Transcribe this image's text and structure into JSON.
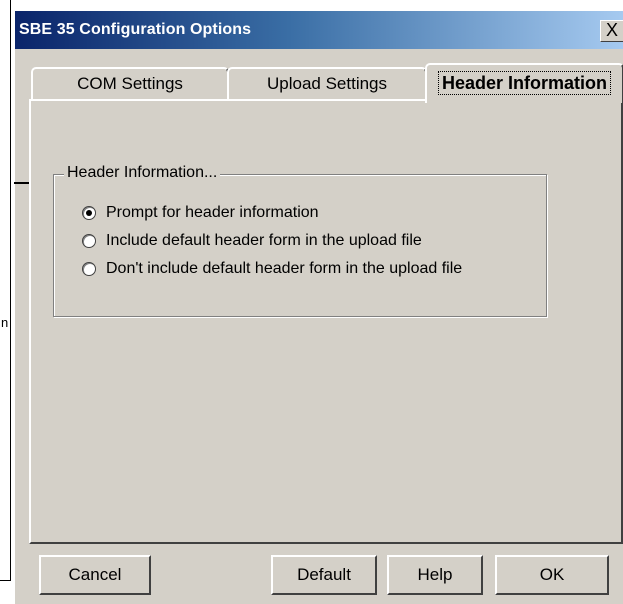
{
  "callout": {
    "text_fragment": "n"
  },
  "window": {
    "title": "SBE 35 Configuration Options",
    "close_label": "X"
  },
  "tabs": [
    {
      "label": "COM Settings",
      "active": false
    },
    {
      "label": "Upload Settings",
      "active": false
    },
    {
      "label": "Header Information",
      "active": true
    }
  ],
  "group": {
    "legend": "Header Information...",
    "options": [
      {
        "label": "Prompt for header information",
        "selected": true
      },
      {
        "label": "Include default header form in the upload file",
        "selected": false
      },
      {
        "label": "Don't include default header form in the upload file",
        "selected": false
      }
    ]
  },
  "buttons": {
    "cancel": "Cancel",
    "default": "Default",
    "help": "Help",
    "ok": "OK"
  }
}
